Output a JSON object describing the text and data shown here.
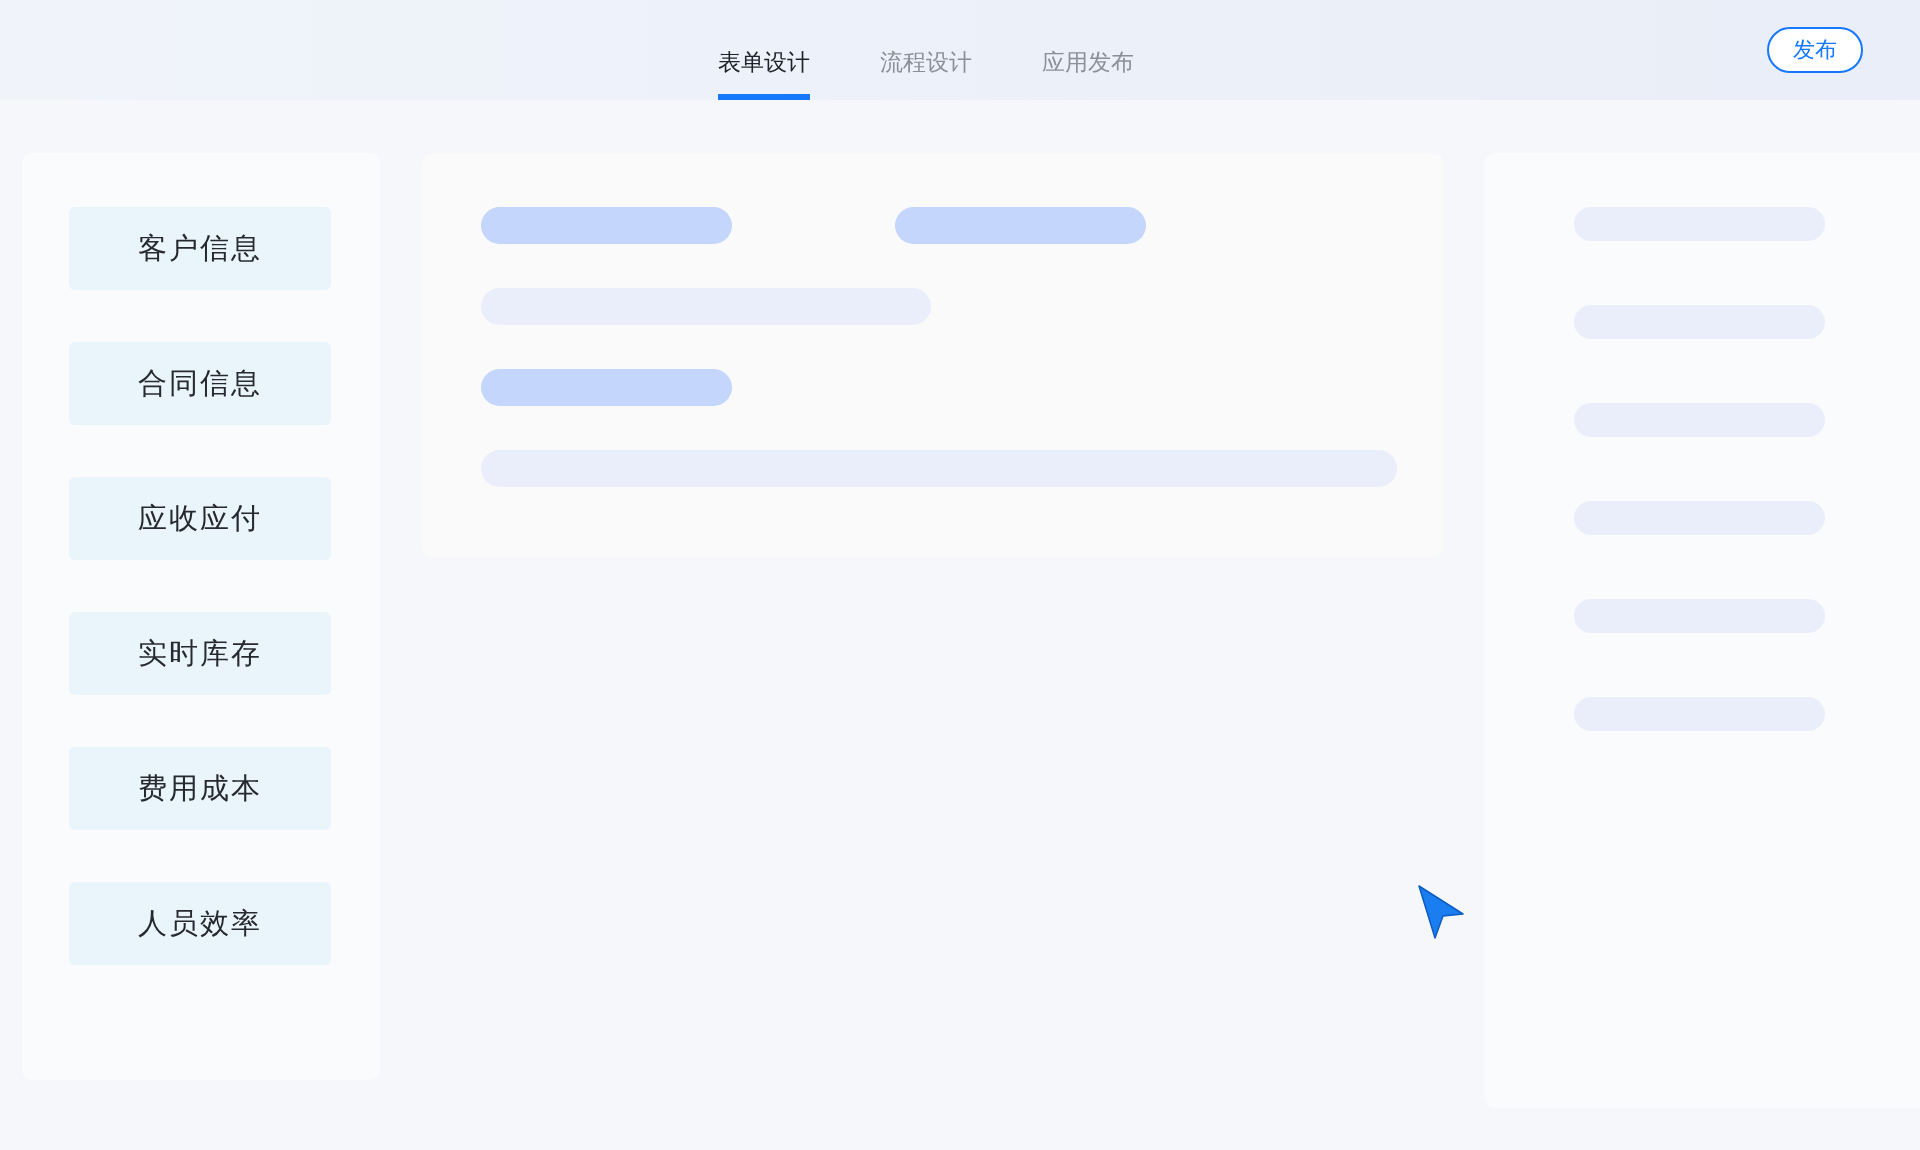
{
  "tabs": [
    {
      "label": "表单设计",
      "selected": true
    },
    {
      "label": "流程设计",
      "selected": false
    },
    {
      "label": "应用发布",
      "selected": false
    }
  ],
  "publish_button": {
    "label": "发布"
  },
  "sidebar": {
    "items": [
      {
        "label": "客户信息"
      },
      {
        "label": "合同信息"
      },
      {
        "label": "应收应付"
      },
      {
        "label": "实时库存"
      },
      {
        "label": "费用成本"
      },
      {
        "label": "人员效率"
      }
    ]
  }
}
